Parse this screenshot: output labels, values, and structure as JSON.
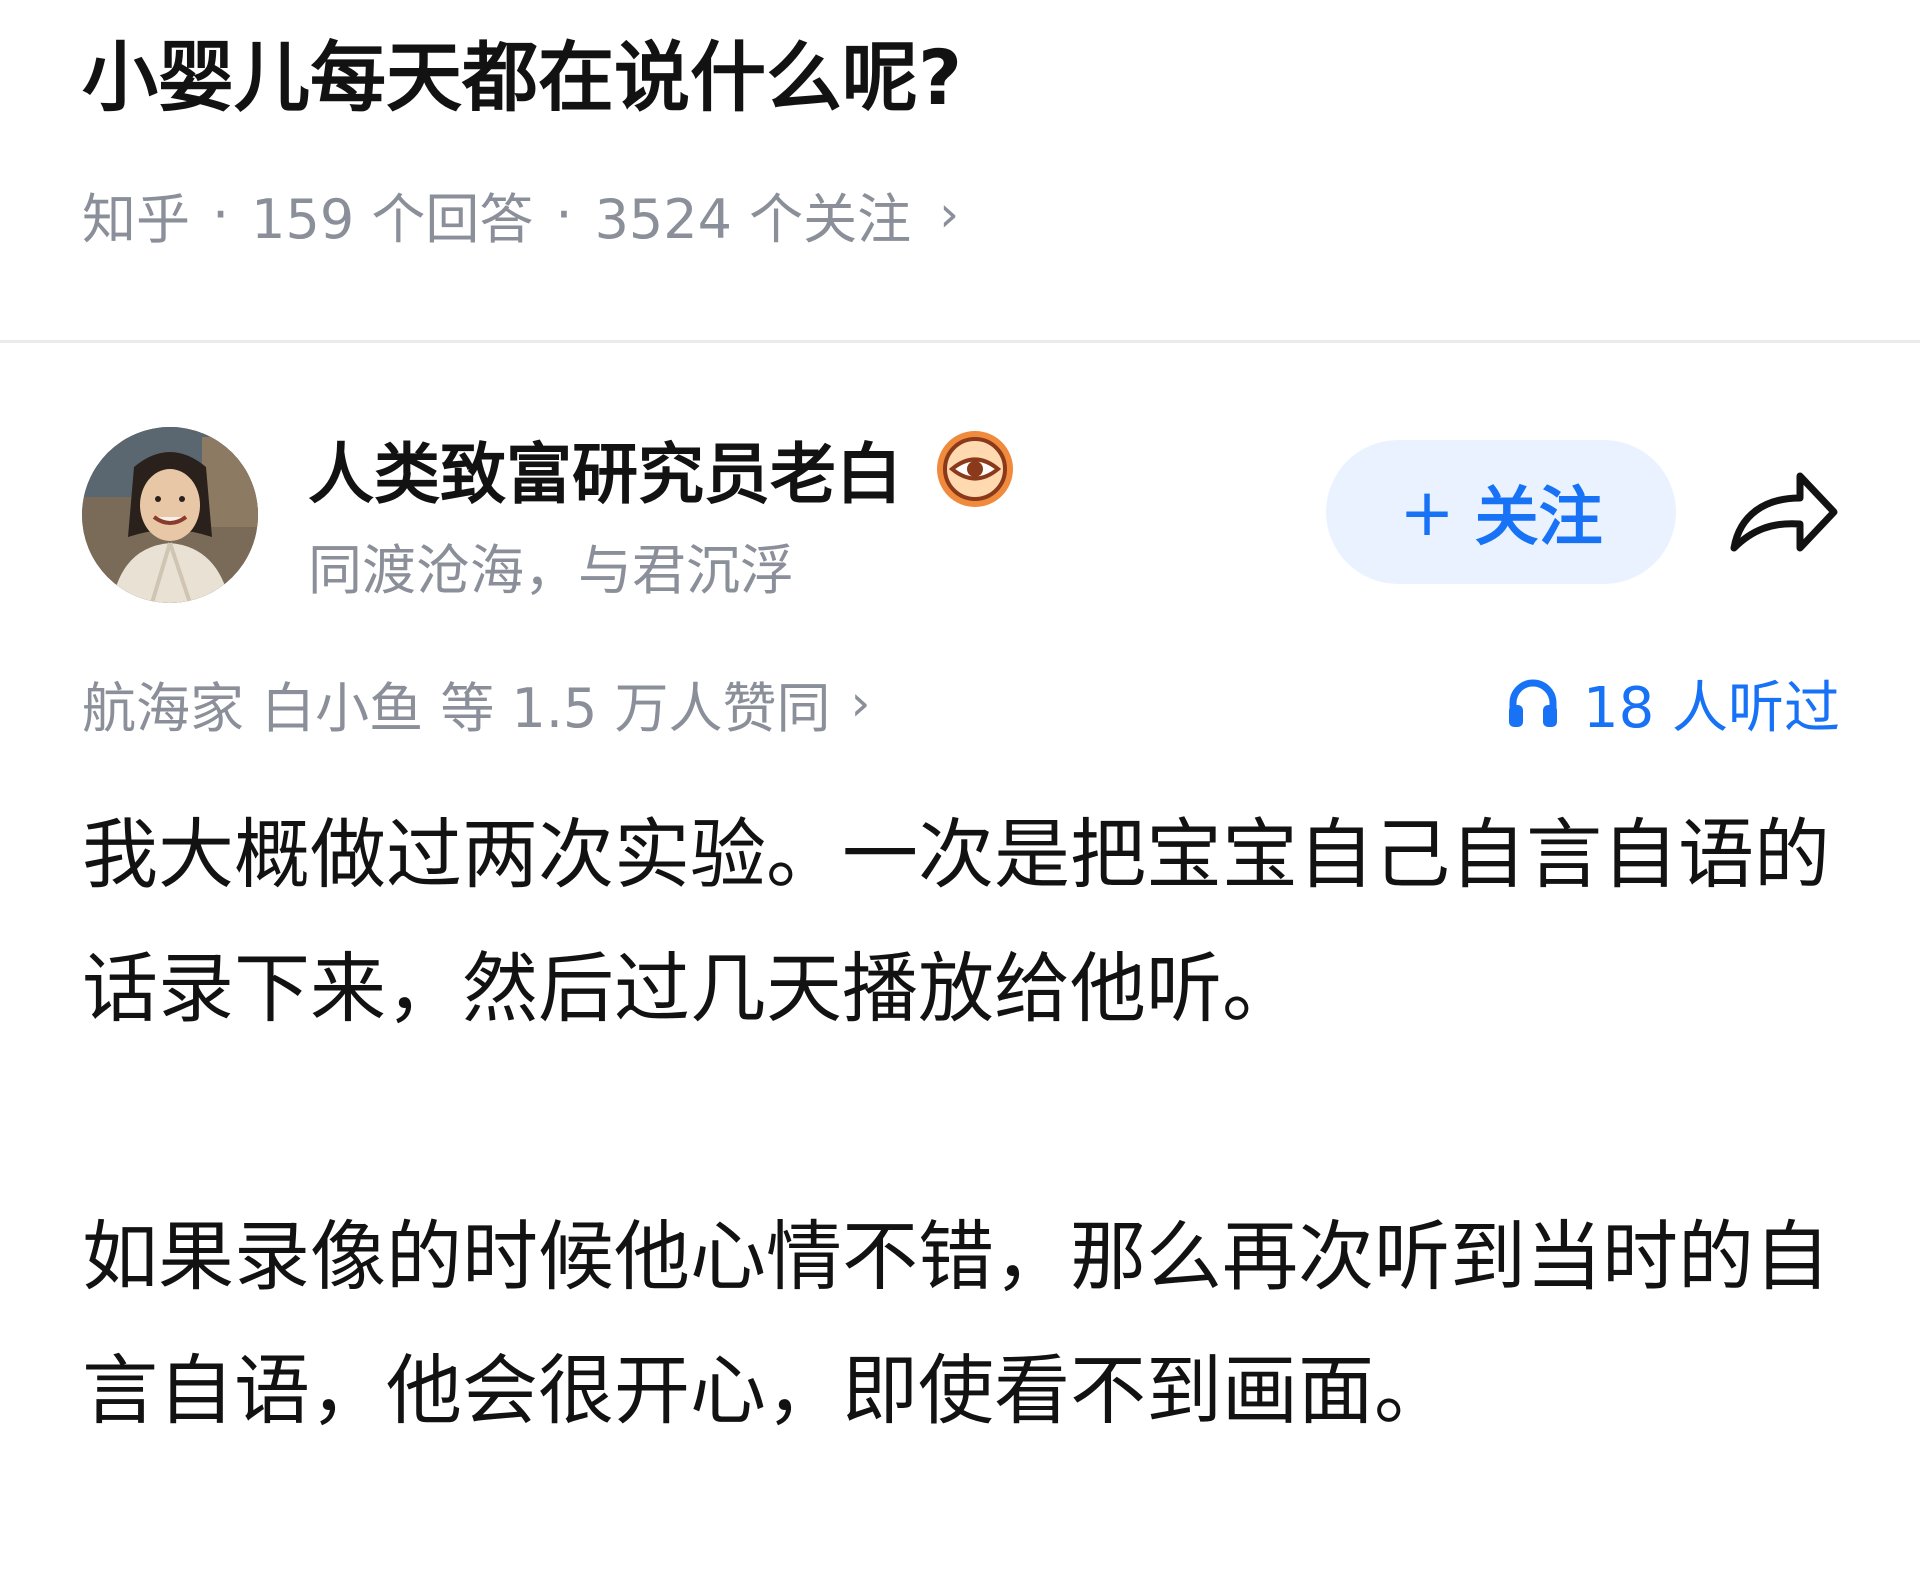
{
  "question": {
    "title": "小婴儿每天都在说什么呢?",
    "source": "知乎",
    "separator": "·",
    "answers_count": "159 个回答",
    "followers_count": "3524 个关注",
    "chevron": "›"
  },
  "author": {
    "name": "人类致富研究员老白",
    "bio": "同渡沧海，与君沉浮",
    "avatar_icon": "avatar-photo",
    "badge_icon": "eye-badge-icon"
  },
  "actions": {
    "follow_plus": "+",
    "follow_label": "关注",
    "share_icon": "share-arrow-icon"
  },
  "stats": {
    "voters": "航海家 白小鱼 等 1.5 万人赞同",
    "voters_chevron": "›",
    "listen_count": "18 人听过",
    "listen_icon": "headphones-icon"
  },
  "answer": {
    "paragraphs": [
      "我大概做过两次实验。一次是把宝宝自己自言自语的话录下来，然后过几天播放给他听。",
      "如果录像的时候他心情不错，那么再次听到当时的自言自语，他会很开心，即使看不到画面。"
    ]
  },
  "colors": {
    "text": "#121212",
    "muted": "#8a8f99",
    "accent": "#1772f6",
    "follow_bg": "#ebf2ff",
    "divider": "#ebebeb"
  }
}
